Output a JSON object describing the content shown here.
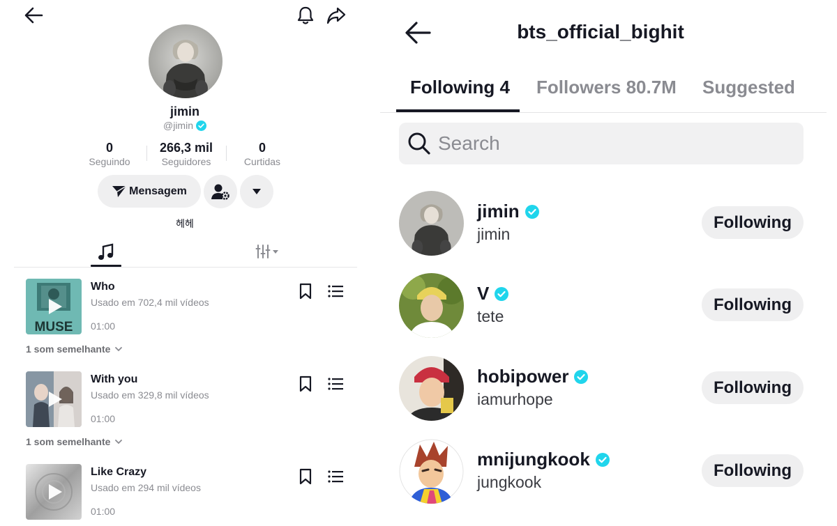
{
  "left_profile": {
    "display_name": "jimin",
    "handle": "@jimin",
    "stats": [
      {
        "value": "0",
        "label": "Seguindo"
      },
      {
        "value": "266,3 mil",
        "label": "Seguidores"
      },
      {
        "value": "0",
        "label": "Curtidas"
      }
    ],
    "message_label": "Mensagem",
    "bio": "헤헤",
    "songs": [
      {
        "title": "Who",
        "uses": "Usado em 702,4 mil vídeos",
        "duration": "01:00",
        "similar": "1 som semelhante",
        "cover_text": "MUSE"
      },
      {
        "title": "With you",
        "uses": "Usado em 329,8 mil vídeos",
        "duration": "01:00",
        "similar": "1 som semelhante",
        "cover_text": ""
      },
      {
        "title": "Like Crazy",
        "uses": "Usado em 294 mil vídeos",
        "duration": "01:00",
        "similar": "",
        "cover_text": ""
      }
    ],
    "icons": [
      "back-arrow-icon",
      "bell-icon",
      "share-icon",
      "verified-icon",
      "send-icon",
      "add-user-settings-icon",
      "caret-down-icon",
      "music-note-icon",
      "filter-icon",
      "play-icon",
      "bookmark-icon",
      "playlist-icon",
      "chevron-down-icon"
    ],
    "colors": {
      "verified": "#20d5ec",
      "button_bg": "#efeff0",
      "muted_text": "#8a8b91"
    }
  },
  "right_following": {
    "title": "bts_official_bighit",
    "tabs": [
      {
        "label": "Following 4",
        "active": true
      },
      {
        "label": "Followers 80.7M",
        "active": false
      },
      {
        "label": "Suggested",
        "active": false
      }
    ],
    "search_placeholder": "Search",
    "users": [
      {
        "username": "jimin",
        "nickname": "jimin",
        "button": "Following",
        "verified": true
      },
      {
        "username": "V",
        "nickname": "tete",
        "button": "Following",
        "verified": true
      },
      {
        "username": "hobipower",
        "nickname": "iamurhope",
        "button": "Following",
        "verified": true
      },
      {
        "username": "mnijungkook",
        "nickname": "jungkook",
        "button": "Following",
        "verified": true
      }
    ],
    "icons": [
      "back-arrow-icon",
      "search-icon",
      "verified-icon"
    ],
    "colors": {
      "verified": "#20d5ec",
      "active_tab": "#161823",
      "inactive_tab": "#8a8b91"
    }
  }
}
